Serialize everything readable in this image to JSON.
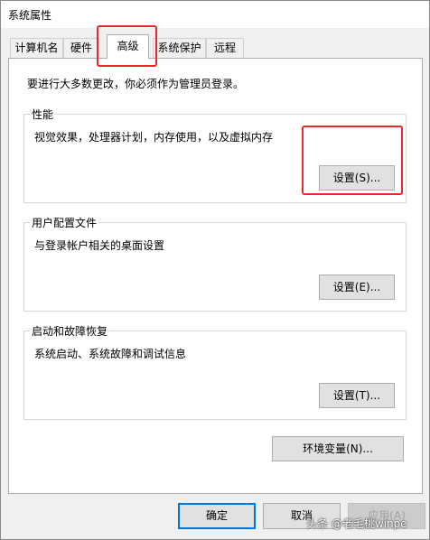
{
  "window": {
    "title": "系统属性"
  },
  "tabs": [
    {
      "label": "计算机名",
      "active": false
    },
    {
      "label": "硬件",
      "active": false
    },
    {
      "label": "高级",
      "active": true
    },
    {
      "label": "系统保护",
      "active": false
    },
    {
      "label": "远程",
      "active": false
    }
  ],
  "admin_note": "要进行大多数更改，你必须作为管理员登录。",
  "groups": {
    "performance": {
      "label": "性能",
      "description": "视觉效果，处理器计划，内存使用，以及虚拟内存",
      "button": "设置(S)..."
    },
    "user_profiles": {
      "label": "用户配置文件",
      "description": "与登录帐户相关的桌面设置",
      "button": "设置(E)..."
    },
    "startup_recovery": {
      "label": "启动和故障恢复",
      "description": "系统启动、系统故障和调试信息",
      "button": "设置(T)..."
    }
  },
  "env_button": "环境变量(N)...",
  "footer": {
    "ok": "确定",
    "cancel": "取消",
    "apply": "应用(A)"
  },
  "watermark": "头条 @老毛桃winpe",
  "colors": {
    "highlight": "#e8282c",
    "focus": "#0078d7"
  }
}
